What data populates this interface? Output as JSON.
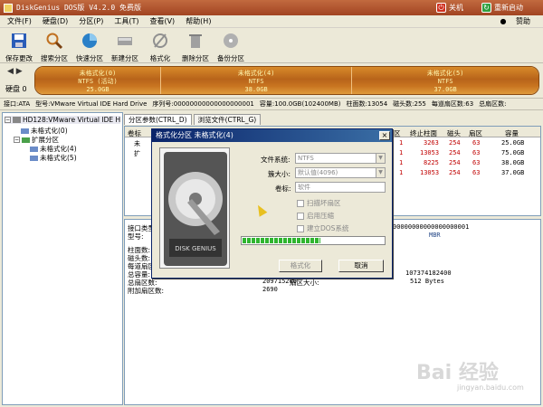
{
  "window": {
    "title": "DiskGenius DOS版 V4.2.0 免费版",
    "shutdown_label": "关机",
    "restart_label": "重新启动"
  },
  "menu": {
    "items": [
      "文件(F)",
      "硬盘(D)",
      "分区(P)",
      "工具(T)",
      "查看(V)",
      "帮助(H)"
    ],
    "donate": "赞助"
  },
  "toolbar": {
    "items": [
      {
        "label": "保存更改",
        "icon": "save-icon",
        "color": "#2a5cb8"
      },
      {
        "label": "搜索分区",
        "icon": "search-icon",
        "color": "#c07020"
      },
      {
        "label": "快速分区",
        "icon": "quick-partition-icon",
        "color": "#2a80c8"
      },
      {
        "label": "新建分区",
        "icon": "new-partition-icon",
        "color": "#808080"
      },
      {
        "label": "格式化",
        "icon": "format-icon",
        "color": "#909090"
      },
      {
        "label": "删除分区",
        "icon": "delete-icon",
        "color": "#909090"
      },
      {
        "label": "备份分区",
        "icon": "backup-icon",
        "color": "#909090"
      }
    ]
  },
  "diskbar": {
    "disk_label": "硬盘 0",
    "partitions": [
      {
        "line1": "未格式化(0)",
        "line2": "NTFS (活动)",
        "line3": "25.0GB"
      },
      {
        "line1": "未格式化(4)",
        "line2": "NTFS",
        "line3": "38.0GB"
      },
      {
        "line1": "未格式化(5)",
        "line2": "NTFS",
        "line3": "37.0GB"
      }
    ]
  },
  "infobar": {
    "items": [
      "接口:ATA",
      "型号:VMware Virtual IDE Hard Drive",
      "序列号:00000000000000000001",
      "容量:100.0GB(102400MB)",
      "柱面数:13054",
      "磁头数:255",
      "每道扇区数:63",
      "总扇区数:"
    ]
  },
  "tree": {
    "disk": "HD128:VMware Virtual IDE H",
    "p0": "未格式化(0)",
    "ext": "扩展分区",
    "p4": "未格式化(4)",
    "p5": "未格式化(5)"
  },
  "tabs": {
    "t1": "分区参数(CTRL_D)",
    "t2": "浏览文件(CTRL_G)"
  },
  "grid": {
    "headers": {
      "vol": "卷标",
      "c1": "区",
      "end_cyl": "终止柱面",
      "head": "磁头",
      "sector": "扇区",
      "cap": "容量"
    },
    "rows": [
      {
        "label": "未",
        "c1": "1",
        "end": "3263",
        "head": "254",
        "sec": "63",
        "cap": "25.0GB"
      },
      {
        "label": "扩",
        "c1": "1",
        "end": "13053",
        "head": "254",
        "sec": "63",
        "cap": "75.0GB"
      },
      {
        "label": "",
        "c1": "1",
        "end": "8225",
        "head": "254",
        "sec": "63",
        "cap": "38.0GB"
      },
      {
        "label": "",
        "c1": "1",
        "end": "13053",
        "head": "254",
        "sec": "63",
        "cap": "37.0GB"
      }
    ]
  },
  "details": {
    "iface_label": "接口类型",
    "iface_value": "00000000000000000001",
    "model_label": "型号:",
    "model_value": "MBR",
    "cyl_label": "柱面数:",
    "heads_label": "磁头数:",
    "spt_label": "每道扇区",
    "cap_label": "总容量:",
    "total_bytes": "107374182400",
    "sectors_label": "总扇区数:",
    "sectors_value": "209715200",
    "sector_size_label": "扇区大小:",
    "sector_size_value": "512 Bytes",
    "extra_label": "附加扇区数:",
    "extra_value": "2690"
  },
  "dialog": {
    "title": "格式化分区 未格式化(4)",
    "fs_label": "文件系统:",
    "fs_value": "NTFS",
    "cluster_label": "簇大小:",
    "cluster_value": "默认值(4096)",
    "volume_label": "卷标:",
    "volume_value": "软件",
    "opt_scan": "扫描坏扇区",
    "opt_compress": "启用压缩",
    "opt_dos": "建立DOS系统",
    "progress": 0.55,
    "format_button": "格式化",
    "cancel_button": "取消",
    "hdd_brand": "DISK GENIUS"
  },
  "watermark": {
    "text": "Bai 经验",
    "sub": "jingyan.baidu.com"
  }
}
